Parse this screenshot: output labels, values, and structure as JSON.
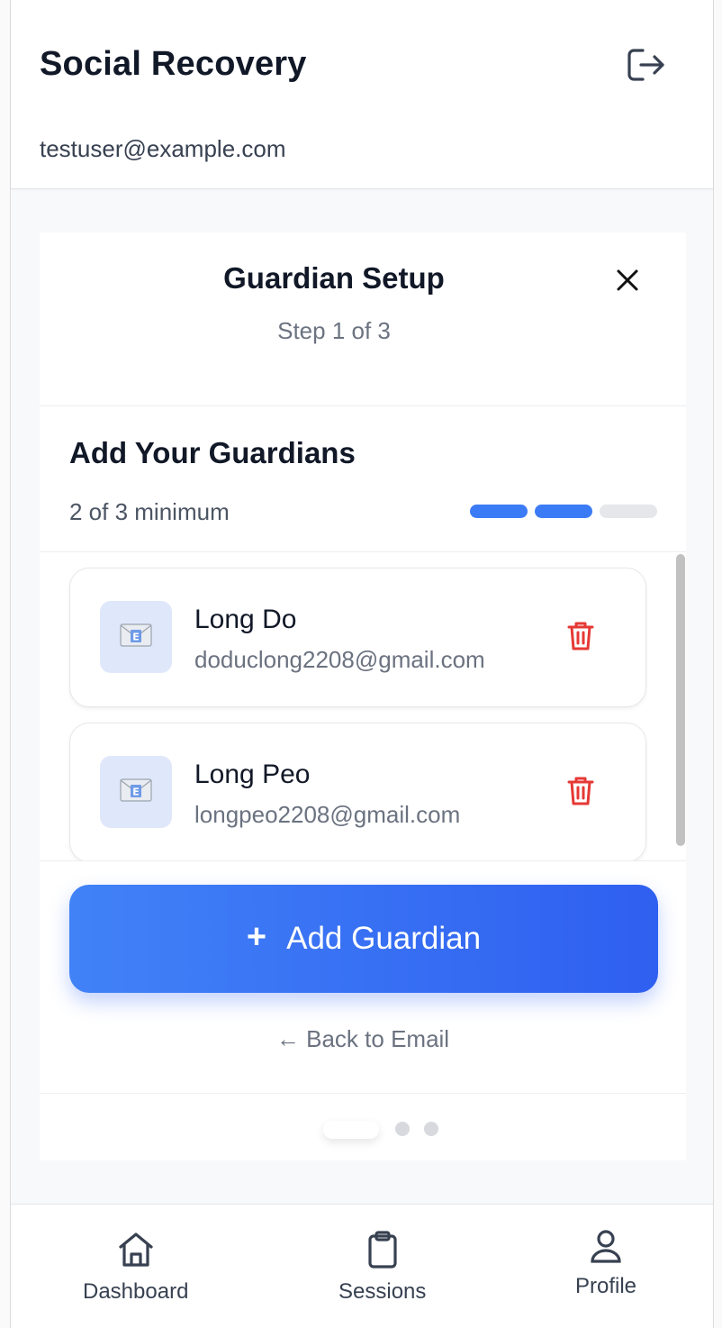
{
  "header": {
    "title": "Social Recovery",
    "user_email": "testuser@example.com",
    "logout_icon": "logout-icon"
  },
  "wizard": {
    "title": "Guardian Setup",
    "step": "Step 1 of 3",
    "close_icon": "close-icon",
    "section_title": "Add Your Guardians",
    "minimum_text": "2 of 3 minimum",
    "progress": {
      "filled": 2,
      "total": 3,
      "filled_color": "#3b7bf5",
      "empty_color": "#e5e7eb"
    },
    "guardians": [
      {
        "name": "Long Do",
        "email": "doduclong2208@gmail.com",
        "icon": "envelope-icon"
      },
      {
        "name": "Long Peo",
        "email": "longpeo2208@gmail.com",
        "icon": "envelope-icon"
      }
    ],
    "add_button": {
      "icon": "+",
      "label": "Add Guardian"
    },
    "back_link": "← Back to Email",
    "pager": {
      "current": 1,
      "total": 3
    }
  },
  "nav": {
    "items": [
      {
        "label": "Dashboard",
        "icon": "home-icon"
      },
      {
        "label": "Sessions",
        "icon": "clipboard-icon"
      },
      {
        "label": "Profile",
        "icon": "user-icon"
      }
    ]
  },
  "colors": {
    "accent": "#3b7bf5",
    "accent_dark": "#2f5ff0",
    "delete": "#e53935",
    "text_primary": "#111827",
    "text_secondary": "#6b7280"
  }
}
